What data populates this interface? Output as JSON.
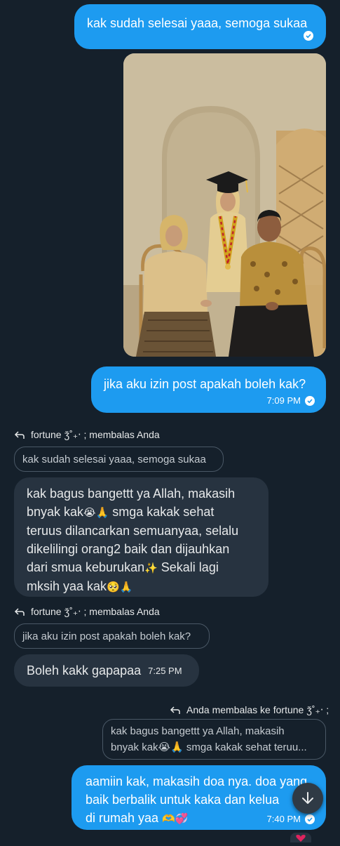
{
  "messages": {
    "m1": {
      "text": "kak sudah selesai yaaa, semoga sukaa"
    },
    "m2": {
      "text": "jika aku izin post apakah boleh kak?",
      "time": "7:09 PM"
    },
    "reply1": {
      "label": "fortune ǯ˚₊‧ ; membalas Anda",
      "quote": "kak sudah selesai yaaa, semoga sukaa"
    },
    "m3": {
      "line1": "kak bagus bangettt ya Allah, makasih",
      "line2a": "bnyak kak",
      "line2b": " smga kakak sehat",
      "line3": "teruus dilancarkan semuanyaa, selalu",
      "line4": "dikelilingi orang2 baik dan dijauhkan",
      "line5a": "dari smua keburukan",
      "line5b": " Sekali lagi",
      "line6": "mksih yaa kak"
    },
    "reply2": {
      "label": "fortune ǯ˚₊‧ ; membalas Anda",
      "quote": "jika aku izin post apakah boleh kak?"
    },
    "m4": {
      "text": "Boleh kakk gapapaa",
      "time": "7:25 PM"
    },
    "reply3": {
      "label": "Anda membalas ke fortune ǯ˚₊‧ ;",
      "quote_line1": "kak bagus bangettt ya Allah, makasih",
      "quote_line2a": "bnyak kak",
      "quote_line2b": " smga kakak sehat teruu..."
    },
    "m5": {
      "line1": "aamiin kak, makasih doa nya. doa yang",
      "line2": "baik berbalik untuk kaka dan kelua",
      "line3": "di rumah yaa",
      "time": "7:40 PM"
    }
  },
  "emoji": {
    "crying": "😭",
    "pray": "🙏",
    "sparkles": "✨",
    "pleading": "🥺",
    "heart_hands": "🫶",
    "hearts": "💞"
  },
  "icons": {
    "reply": "reply-arrow-icon",
    "check": "checkmark-icon",
    "scroll_down": "arrow-down-icon"
  },
  "colors": {
    "background": "#15202b",
    "outgoing_bubble": "#1d9bf0",
    "incoming_bubble": "#273340"
  }
}
